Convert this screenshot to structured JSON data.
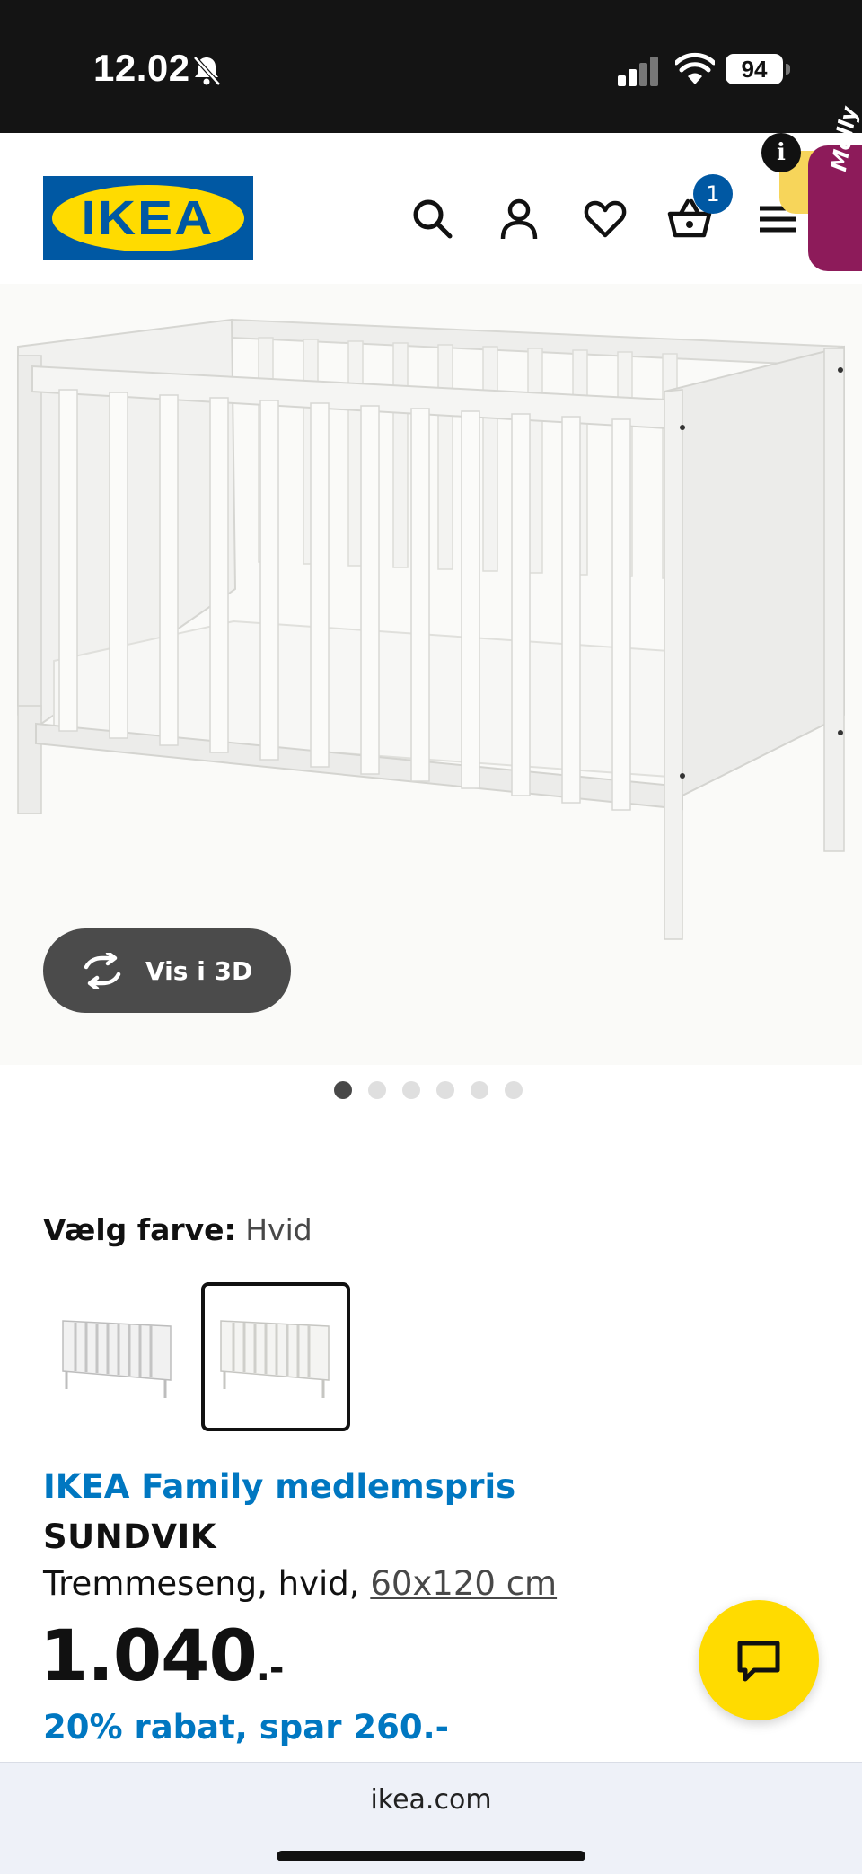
{
  "status_bar": {
    "time": "12.02",
    "battery": "94"
  },
  "header": {
    "logo_text": "IKEA",
    "cart_count": "1",
    "info_label": "i",
    "molly_label": "Molly",
    "icons": [
      "search-icon",
      "profile-icon",
      "heart-icon",
      "cart-icon",
      "menu-icon"
    ]
  },
  "gallery": {
    "view3d_label": "Vis i 3D",
    "dots_total": 6,
    "active_dot": 0
  },
  "color_picker": {
    "label": "Vælg farve:",
    "selected_value": "Hvid",
    "selected_index": 1
  },
  "product": {
    "family_label": "IKEA Family medlemspris",
    "name": "SUNDVIK",
    "description": "Tremmeseng, hvid,",
    "size_link": "60x120 cm",
    "price": "1.040",
    "price_suffix": ".-",
    "discount": "20% rabat, spar 260.-"
  },
  "browser": {
    "url": "ikea.com"
  },
  "colors": {
    "ikea_blue": "#0058a3",
    "ikea_yellow": "#ffdb00",
    "family_blue": "#0077c1"
  }
}
